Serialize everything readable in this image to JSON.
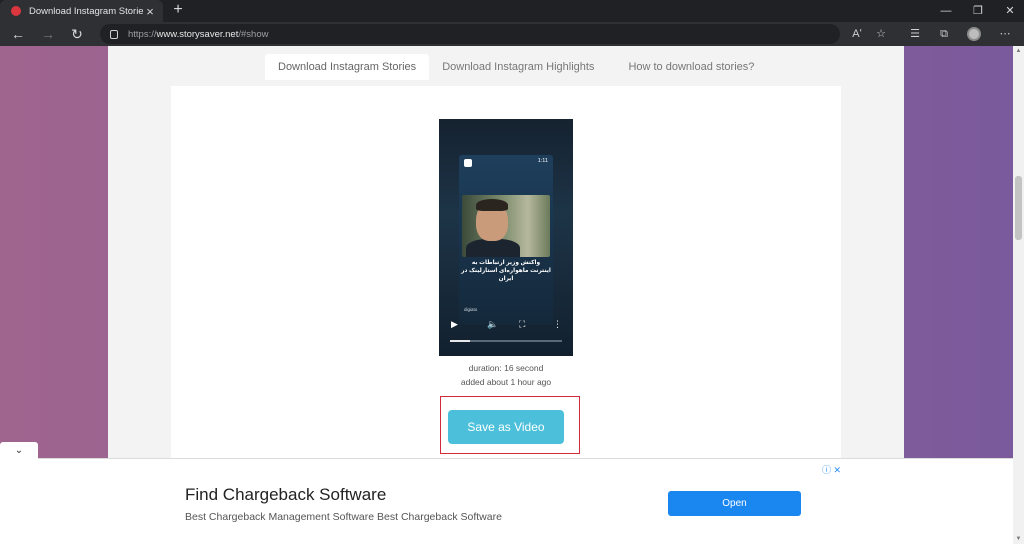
{
  "browser": {
    "tab_title": "Download Instagram Stories and",
    "tab_close": "×",
    "new_tab": "+",
    "url_prefix": "https://",
    "url_host": "www.storysaver.net",
    "url_path": "/#show",
    "read_aloud": "Aʹ"
  },
  "nav": {
    "tabs": [
      {
        "label": "Download Instagram Stories"
      },
      {
        "label": "Download Instagram Highlights"
      },
      {
        "label": "How to download stories?"
      }
    ]
  },
  "story": {
    "time": "1:11",
    "caption": "واکنش وزیر ارتباطات به اینترنت ماهواره‌ای استارلینک در ایران",
    "brand": "digiato",
    "progress": 0.18
  },
  "meta": {
    "duration": "duration: 16 second",
    "added": "added about 1 hour ago"
  },
  "save": {
    "label": "Save as Video"
  },
  "ad": {
    "title": "Find Chargeback Software",
    "description": "Best Chargeback Management Software Best Chargeback Software",
    "button": "Open",
    "choices": "ⓘ ✕"
  },
  "colors": {
    "accent": "#4cc0da",
    "highlight": "#d62a3c",
    "ad_button": "#1a86f0"
  }
}
